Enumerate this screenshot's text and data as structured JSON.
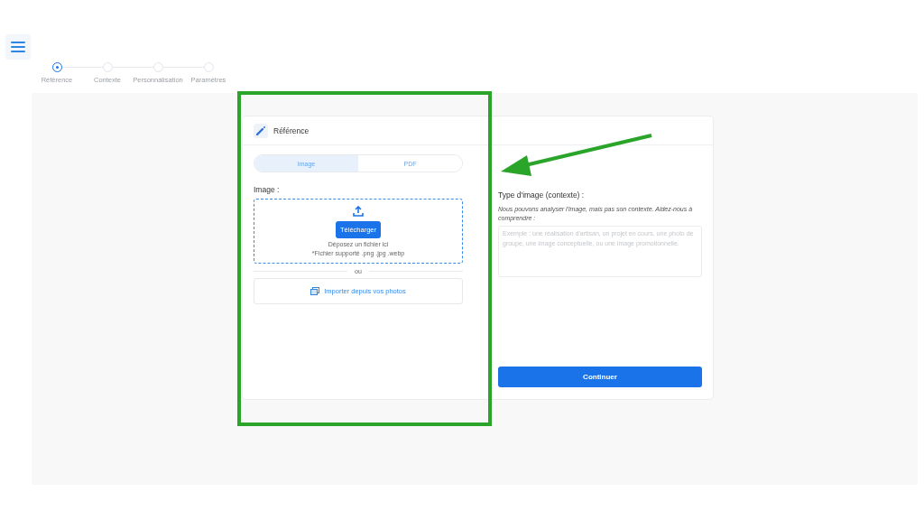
{
  "steps": [
    {
      "label": "Référence",
      "selected": true
    },
    {
      "label": "Contexte",
      "selected": false
    },
    {
      "label": "Personnalisation",
      "selected": false
    },
    {
      "label": "Paramètres",
      "selected": false
    }
  ],
  "card": {
    "title": "Référence",
    "tabs": [
      {
        "label": "Image",
        "selected": true
      },
      {
        "label": "PDF",
        "selected": false
      }
    ],
    "image_label": "Image :",
    "upload_button": "Télécharger",
    "drop_hint": "Déposez un fichier ici",
    "supported": "*Fichier supporté .png .jpg .webp",
    "separator": "ou",
    "import_button": "Importer depuis vos photos",
    "context_title": "Type d'image (contexte) :",
    "context_help": "Nous pouvons analyser l'image, mais pas son contexte. Aidez-nous à comprendre :",
    "context_placeholder": "Exemple : une réalisation d'artisan, un projet en cours, une photo de groupe, une image conceptuelle, ou une image promotionnelle.",
    "continue_button": "Continuer"
  }
}
